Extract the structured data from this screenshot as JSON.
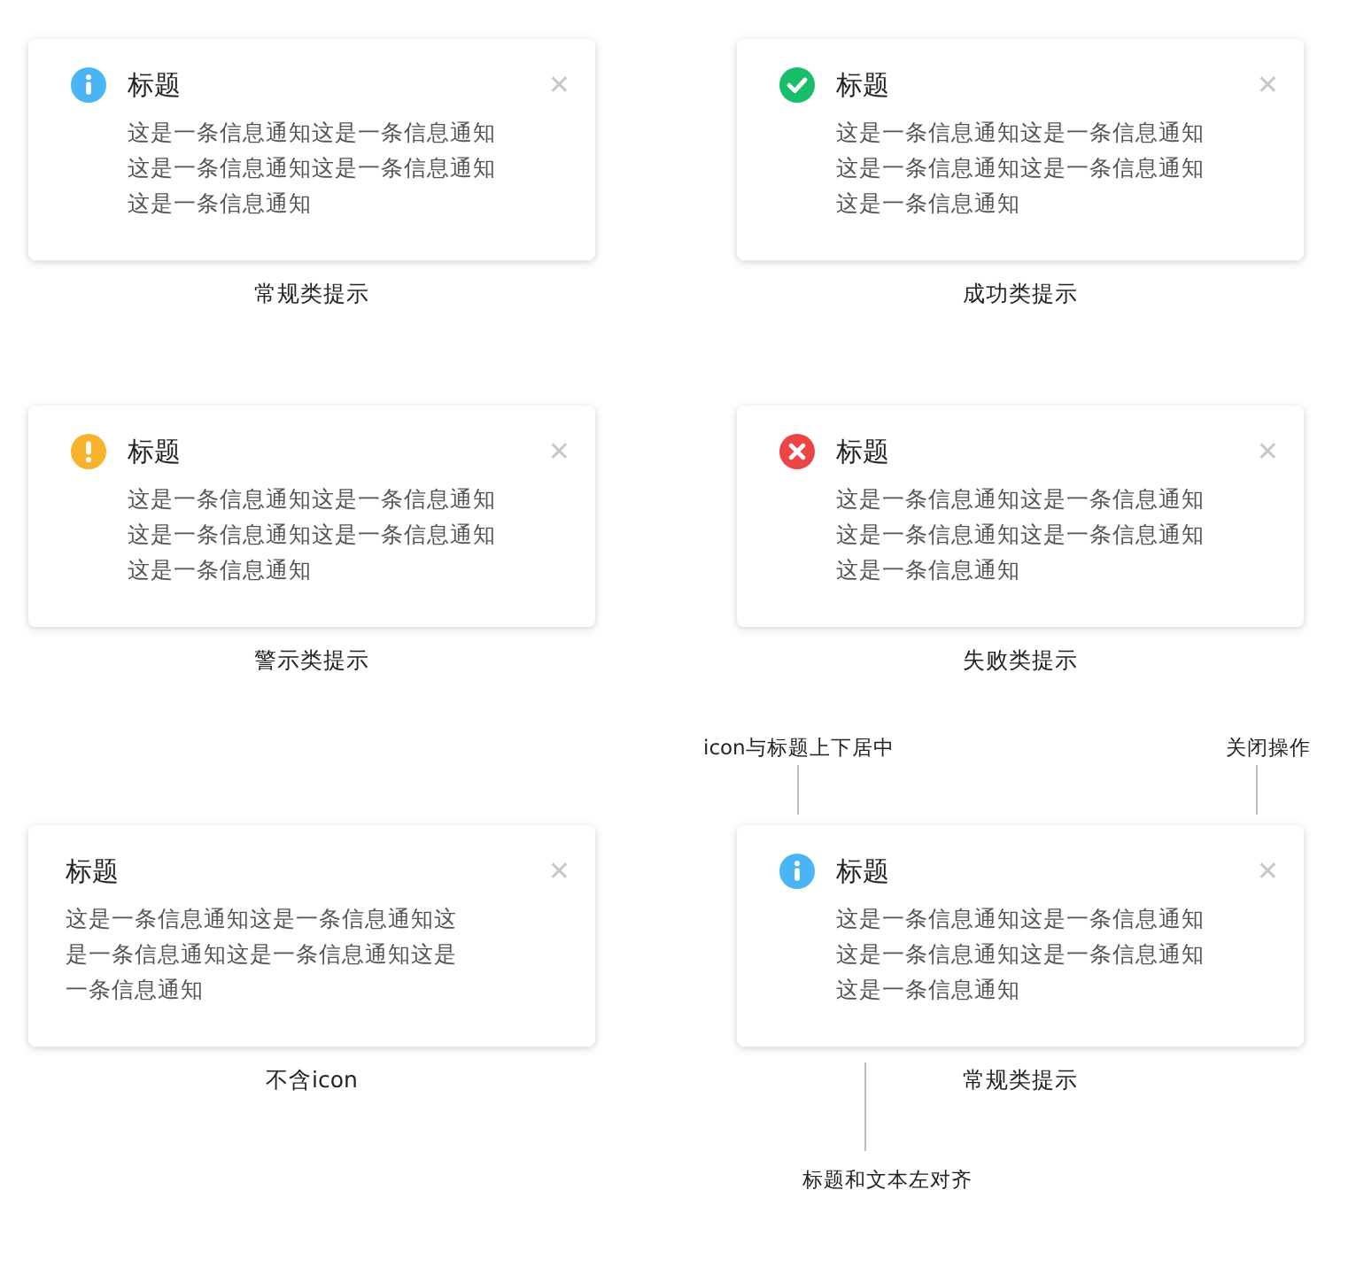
{
  "notices": [
    {
      "kind": "info",
      "title": "标题",
      "body": "这是一条信息通知这是一条信息通知这是一条信息通知这是一条信息通知这是一条信息通知",
      "close": "✕",
      "caption": "常规类提示"
    },
    {
      "kind": "success",
      "title": "标题",
      "body": "这是一条信息通知这是一条信息通知这是一条信息通知这是一条信息通知这是一条信息通知",
      "close": "✕",
      "caption": "成功类提示"
    },
    {
      "kind": "warning",
      "title": "标题",
      "body": "这是一条信息通知这是一条信息通知这是一条信息通知这是一条信息通知这是一条信息通知",
      "close": "✕",
      "caption": "警示类提示"
    },
    {
      "kind": "error",
      "title": "标题",
      "body": "这是一条信息通知这是一条信息通知这是一条信息通知这是一条信息通知这是一条信息通知",
      "close": "✕",
      "caption": "失败类提示"
    },
    {
      "kind": "none",
      "title": "标题",
      "body": "这是一条信息通知这是一条信息通知这是一条信息通知这是一条信息通知这是一条信息通知",
      "close": "✕",
      "caption": "不含icon"
    },
    {
      "kind": "info",
      "title": "标题",
      "body": "这是一条信息通知这是一条信息通知这是一条信息通知这是一条信息通知这是一条信息通知",
      "close": "✕",
      "caption": "常规类提示",
      "annotations": {
        "icon": "icon与标题上下居中",
        "close": "关闭操作",
        "align": "标题和文本左对齐"
      }
    }
  ]
}
